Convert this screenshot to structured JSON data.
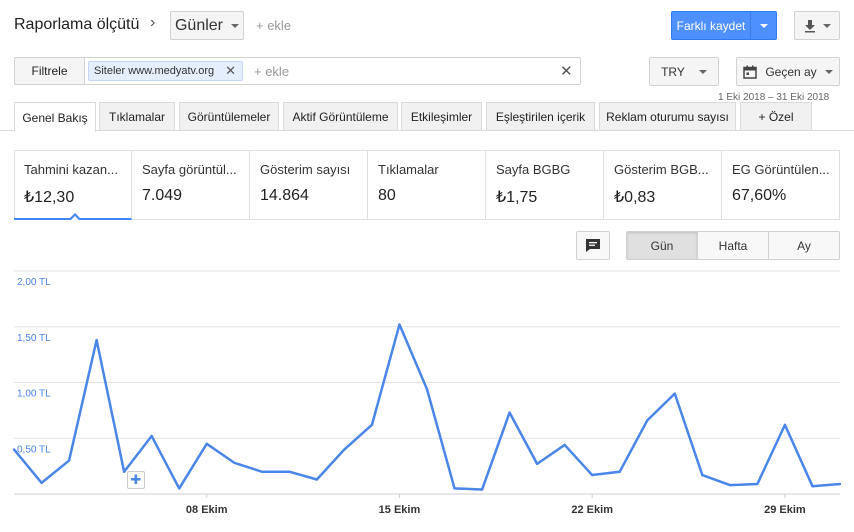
{
  "header": {
    "title": "Raporlama ölçütü",
    "dimension": "Günler",
    "add_label": "+ ekle",
    "save_as": "Farklı kaydet"
  },
  "filter": {
    "filter_button": "Filtrele",
    "chip_prefix": "Siteler",
    "chip_value": "www.medyatv.org",
    "add_label": "+ ekle"
  },
  "currency": "TRY",
  "date_range": {
    "label": "Geçen ay",
    "range_text": "1 Eki 2018 – 31 Eki 2018"
  },
  "tabs": [
    {
      "label": "Genel Bakış"
    },
    {
      "label": "Tıklamalar"
    },
    {
      "label": "Görüntülemeler"
    },
    {
      "label": "Aktif Görüntüleme"
    },
    {
      "label": "Etkileşimler"
    },
    {
      "label": "Eşleştirilen içerik"
    },
    {
      "label": "Reklam oturumu sayısı"
    },
    {
      "label": "+ Özel"
    }
  ],
  "metrics": [
    {
      "label": "Tahmini kazan...",
      "value": "₺12,30"
    },
    {
      "label": "Sayfa görüntül...",
      "value": "7.049"
    },
    {
      "label": "Gösterim sayısı",
      "value": "14.864"
    },
    {
      "label": "Tıklamalar",
      "value": "80"
    },
    {
      "label": "Sayfa BGBG",
      "value": "₺1,75"
    },
    {
      "label": "Gösterim BGB...",
      "value": "₺0,83"
    },
    {
      "label": "EG Görüntülen...",
      "value": "67,60%"
    }
  ],
  "granularity": {
    "day": "Gün",
    "week": "Hafta",
    "month": "Ay"
  },
  "colors": {
    "accent": "#4285f4",
    "line": "#4a86e8",
    "save_blue": "#4d90fe"
  },
  "chart_data": {
    "type": "line",
    "x": [
      1,
      2,
      3,
      4,
      5,
      6,
      7,
      8,
      9,
      10,
      11,
      12,
      13,
      14,
      15,
      16,
      17,
      18,
      19,
      20,
      21,
      22,
      23,
      24,
      25,
      26,
      27,
      28,
      29,
      30,
      31
    ],
    "series": [
      {
        "values": [
          0.4,
          0.1,
          0.3,
          1.38,
          0.2,
          0.52,
          0.05,
          0.45,
          0.28,
          0.2,
          0.2,
          0.13,
          0.4,
          0.62,
          1.52,
          0.94,
          0.05,
          0.04,
          0.73,
          0.27,
          0.44,
          0.17,
          0.2,
          0.66,
          0.9,
          0.17,
          0.08,
          0.09,
          0.62,
          0.07,
          0.09
        ]
      }
    ],
    "y_ticks": [
      {
        "value": 0.5,
        "label": "0,50 TL"
      },
      {
        "value": 1.0,
        "label": "1,00 TL"
      },
      {
        "value": 1.5,
        "label": "1,50 TL"
      },
      {
        "value": 2.0,
        "label": "2,00 TL"
      }
    ],
    "x_ticks": [
      {
        "value": 8,
        "label": "08 Ekim"
      },
      {
        "value": 15,
        "label": "15 Ekim"
      },
      {
        "value": 22,
        "label": "22 Ekim"
      },
      {
        "value": 29,
        "label": "29 Ekim"
      }
    ],
    "ylim": [
      0,
      2.0
    ],
    "xlim": [
      1,
      31
    ],
    "grid": true
  }
}
